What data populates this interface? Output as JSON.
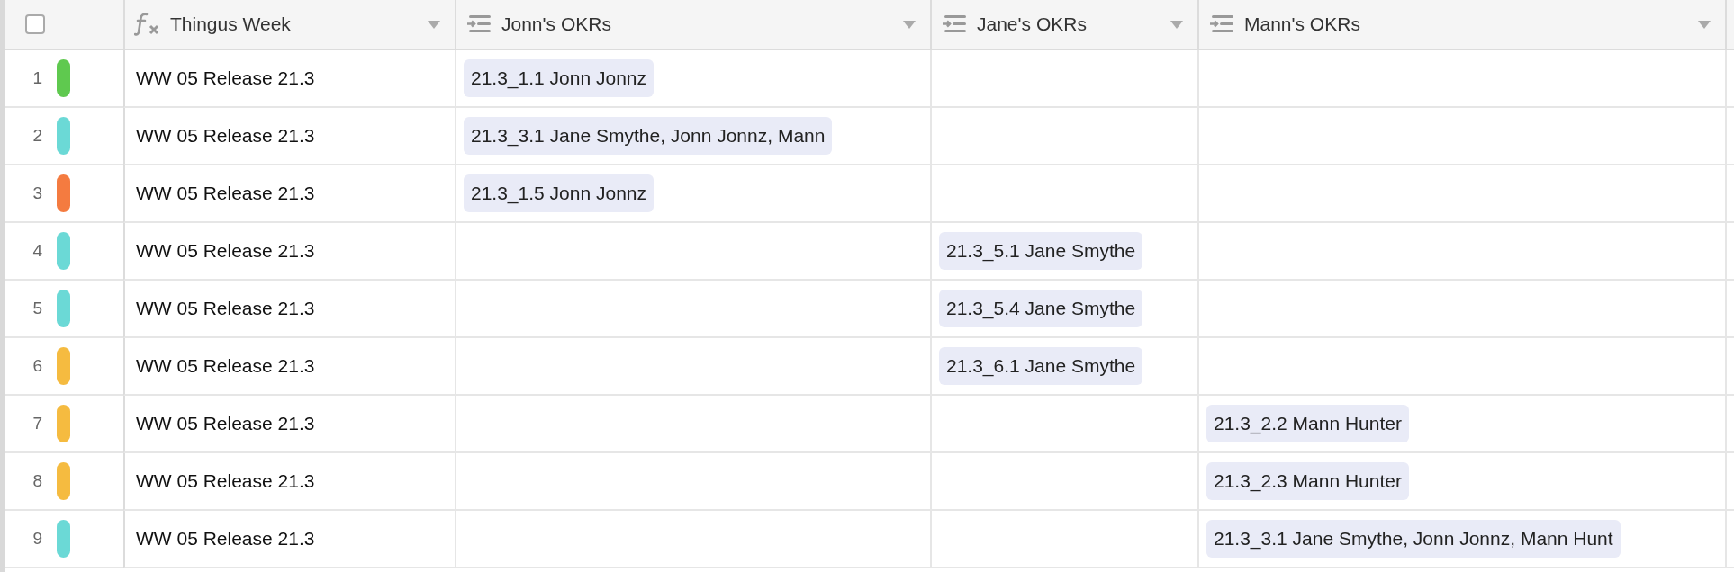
{
  "header": {
    "select_all": {
      "checked": false
    },
    "columns": [
      {
        "label": "Thingus Week",
        "kind": "formula"
      },
      {
        "label": "Jonn's OKRs",
        "kind": "link"
      },
      {
        "label": "Jane's OKRs",
        "kind": "link"
      },
      {
        "label": "Mann's OKRs",
        "kind": "link"
      }
    ]
  },
  "rows": [
    {
      "number": "1",
      "color": "#5fc94f",
      "thingus_week": "WW 05 Release 21.3",
      "jonns_okrs": [
        "21.3_1.1 Jonn Jonnz"
      ],
      "janes_okrs": [],
      "manns_okrs": []
    },
    {
      "number": "2",
      "color": "#6bd9d6",
      "thingus_week": "WW 05 Release 21.3",
      "jonns_okrs": [
        "21.3_3.1 Jane Smythe, Jonn Jonnz, Mann"
      ],
      "janes_okrs": [],
      "manns_okrs": []
    },
    {
      "number": "3",
      "color": "#f47b40",
      "thingus_week": "WW 05 Release 21.3",
      "jonns_okrs": [
        "21.3_1.5 Jonn Jonnz"
      ],
      "janes_okrs": [],
      "manns_okrs": []
    },
    {
      "number": "4",
      "color": "#6bd9d6",
      "thingus_week": "WW 05 Release 21.3",
      "jonns_okrs": [],
      "janes_okrs": [
        "21.3_5.1 Jane Smythe"
      ],
      "manns_okrs": []
    },
    {
      "number": "5",
      "color": "#6bd9d6",
      "thingus_week": "WW 05 Release 21.3",
      "jonns_okrs": [],
      "janes_okrs": [
        "21.3_5.4 Jane Smythe"
      ],
      "manns_okrs": []
    },
    {
      "number": "6",
      "color": "#f5bb40",
      "thingus_week": "WW 05 Release 21.3",
      "jonns_okrs": [],
      "janes_okrs": [
        "21.3_6.1 Jane Smythe"
      ],
      "manns_okrs": []
    },
    {
      "number": "7",
      "color": "#f5bb40",
      "thingus_week": "WW 05 Release 21.3",
      "jonns_okrs": [],
      "janes_okrs": [],
      "manns_okrs": [
        "21.3_2.2 Mann Hunter"
      ]
    },
    {
      "number": "8",
      "color": "#f5bb40",
      "thingus_week": "WW 05 Release 21.3",
      "jonns_okrs": [],
      "janes_okrs": [],
      "manns_okrs": [
        "21.3_2.3 Mann Hunter"
      ]
    },
    {
      "number": "9",
      "color": "#6bd9d6",
      "thingus_week": "WW 05 Release 21.3",
      "jonns_okrs": [],
      "janes_okrs": [],
      "manns_okrs": [
        "21.3_3.1 Jane Smythe, Jonn Jonnz, Mann Hunt"
      ]
    }
  ]
}
